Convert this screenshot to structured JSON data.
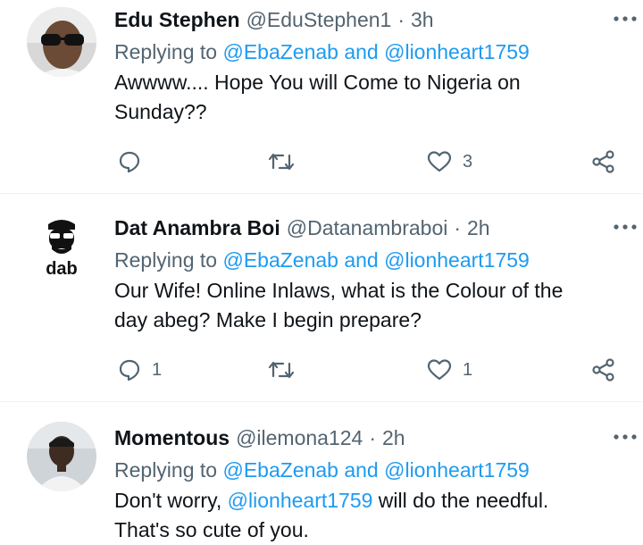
{
  "tweets": [
    {
      "name": "Edu Stephen",
      "handle": "@EduStephen1",
      "separator": "·",
      "time": "3h",
      "replying_prefix": "Replying to",
      "replying_targets": "@EbaZenab and @lionheart1759",
      "text_line1": "Awwww.... Hope You will Come to Nigeria on",
      "text_line2": "Sunday??",
      "reply_count": "",
      "retweet_count": "",
      "like_count": "3"
    },
    {
      "name": "Dat Anambra Boi",
      "handle": "@Datanambraboi",
      "separator": "·",
      "time": "2h",
      "avatar_text": "dab",
      "replying_prefix": "Replying to",
      "replying_targets": "@EbaZenab and @lionheart1759",
      "text_line1": "Our Wife! Online Inlaws, what is the Colour of the",
      "text_line2": "day abeg? Make I begin prepare?",
      "reply_count": "1",
      "retweet_count": "",
      "like_count": "1"
    },
    {
      "name": "Momentous",
      "handle": "@ilemona124",
      "separator": "·",
      "time": "2h",
      "replying_prefix": "Replying to",
      "replying_targets": "@EbaZenab and @lionheart1759",
      "text_before_mention": "Don't worry, ",
      "text_mention": "@lionheart1759",
      "text_after_mention": " will do the needful.",
      "text_line2": "That's so cute of you."
    }
  ],
  "icons": {
    "more": "more-horizontal-icon",
    "reply": "reply-icon",
    "retweet": "retweet-icon",
    "like": "heart-icon",
    "share": "share-icon"
  },
  "colors": {
    "link": "#1d9bf0",
    "secondary_text": "#536471",
    "primary_text": "#0f1419",
    "divider": "#eff3f4"
  }
}
